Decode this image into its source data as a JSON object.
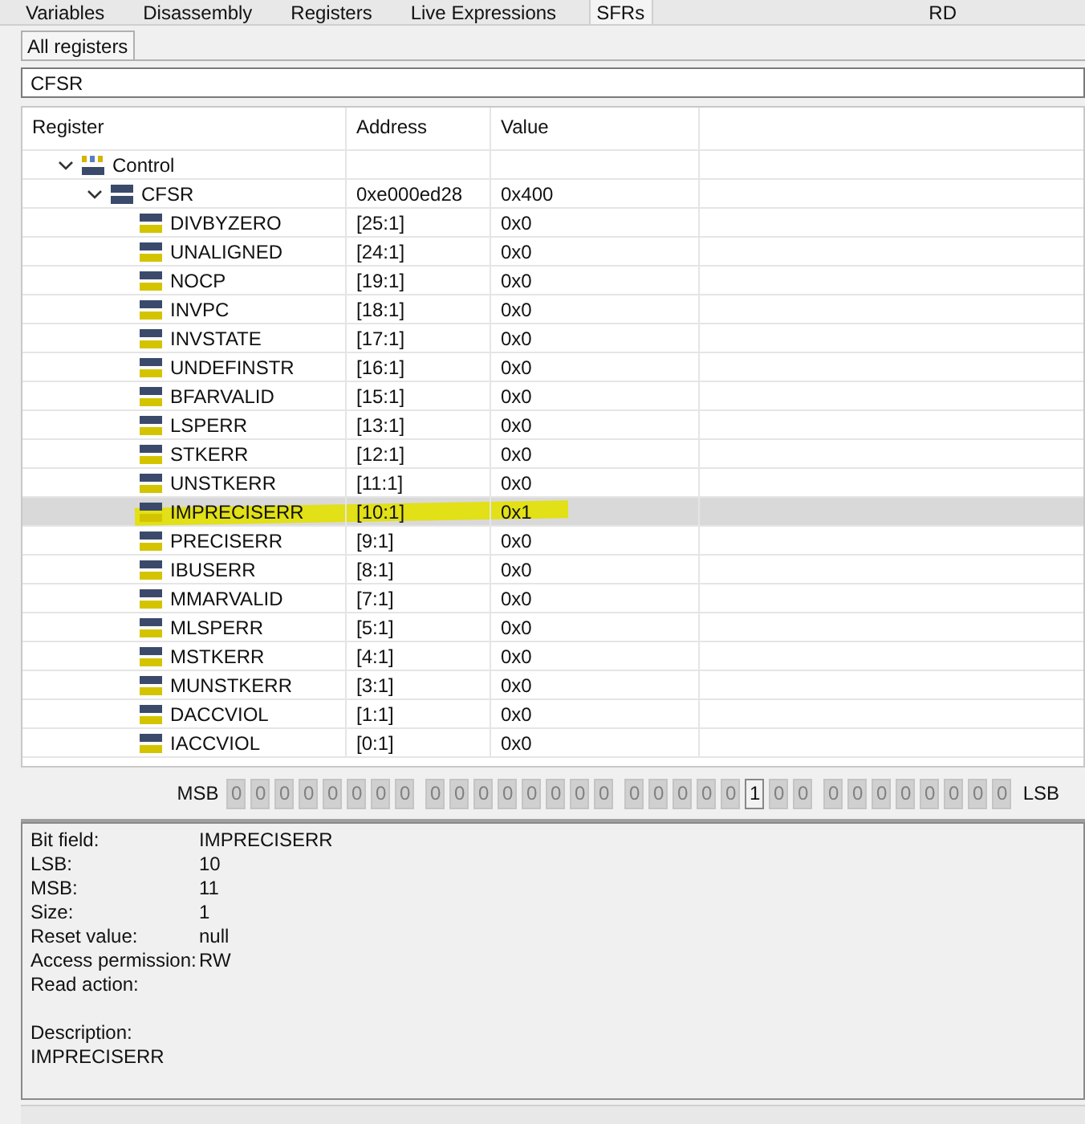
{
  "view_tabs": [
    {
      "label": "Variables",
      "selected": false
    },
    {
      "label": "Disassembly",
      "selected": false
    },
    {
      "label": "Registers",
      "selected": false
    },
    {
      "label": "Live Expressions",
      "selected": false
    },
    {
      "label": "SFRs",
      "selected": true
    }
  ],
  "toolbar": {
    "format_label": "RD"
  },
  "sub_tabs": [
    {
      "label": "All registers",
      "selected": true
    }
  ],
  "filter": {
    "value": "CFSR"
  },
  "table": {
    "columns": [
      "Register",
      "Address",
      "Value"
    ],
    "rows": [
      {
        "name": "Control",
        "kind": "group",
        "expanded": true,
        "selected": false,
        "marked": false,
        "children": [
          {
            "name": "CFSR",
            "kind": "register",
            "expanded": true,
            "address": "0xe000ed28",
            "value": "0x400",
            "selected": false,
            "marked": false,
            "children": [
              {
                "name": "DIVBYZERO",
                "kind": "field",
                "address": "[25:1]",
                "value": "0x0",
                "selected": false,
                "marked": false
              },
              {
                "name": "UNALIGNED",
                "kind": "field",
                "address": "[24:1]",
                "value": "0x0",
                "selected": false,
                "marked": false
              },
              {
                "name": "NOCP",
                "kind": "field",
                "address": "[19:1]",
                "value": "0x0",
                "selected": false,
                "marked": false
              },
              {
                "name": "INVPC",
                "kind": "field",
                "address": "[18:1]",
                "value": "0x0",
                "selected": false,
                "marked": false
              },
              {
                "name": "INVSTATE",
                "kind": "field",
                "address": "[17:1]",
                "value": "0x0",
                "selected": false,
                "marked": false
              },
              {
                "name": "UNDEFINSTR",
                "kind": "field",
                "address": "[16:1]",
                "value": "0x0",
                "selected": false,
                "marked": false
              },
              {
                "name": "BFARVALID",
                "kind": "field",
                "address": "[15:1]",
                "value": "0x0",
                "selected": false,
                "marked": false
              },
              {
                "name": "LSPERR",
                "kind": "field",
                "address": "[13:1]",
                "value": "0x0",
                "selected": false,
                "marked": false
              },
              {
                "name": "STKERR",
                "kind": "field",
                "address": "[12:1]",
                "value": "0x0",
                "selected": false,
                "marked": false
              },
              {
                "name": "UNSTKERR",
                "kind": "field",
                "address": "[11:1]",
                "value": "0x0",
                "selected": false,
                "marked": false
              },
              {
                "name": "IMPRECISERR",
                "kind": "field",
                "address": "[10:1]",
                "value": "0x1",
                "selected": true,
                "marked": true
              },
              {
                "name": "PRECISERR",
                "kind": "field",
                "address": "[9:1]",
                "value": "0x0",
                "selected": false,
                "marked": false
              },
              {
                "name": "IBUSERR",
                "kind": "field",
                "address": "[8:1]",
                "value": "0x0",
                "selected": false,
                "marked": false
              },
              {
                "name": "MMARVALID",
                "kind": "field",
                "address": "[7:1]",
                "value": "0x0",
                "selected": false,
                "marked": false
              },
              {
                "name": "MLSPERR",
                "kind": "field",
                "address": "[5:1]",
                "value": "0x0",
                "selected": false,
                "marked": false
              },
              {
                "name": "MSTKERR",
                "kind": "field",
                "address": "[4:1]",
                "value": "0x0",
                "selected": false,
                "marked": false
              },
              {
                "name": "MUNSTKERR",
                "kind": "field",
                "address": "[3:1]",
                "value": "0x0",
                "selected": false,
                "marked": false
              },
              {
                "name": "DACCVIOL",
                "kind": "field",
                "address": "[1:1]",
                "value": "0x0",
                "selected": false,
                "marked": false
              },
              {
                "name": "IACCVIOL",
                "kind": "field",
                "address": "[0:1]",
                "value": "0x0",
                "selected": false,
                "marked": false
              }
            ]
          }
        ]
      }
    ]
  },
  "bits": {
    "msb_label": "MSB",
    "lsb_label": "LSB",
    "groups": [
      [
        {
          "value": "0",
          "selected": false
        },
        {
          "value": "0",
          "selected": false
        },
        {
          "value": "0",
          "selected": false
        },
        {
          "value": "0",
          "selected": false
        },
        {
          "value": "0",
          "selected": false
        },
        {
          "value": "0",
          "selected": false
        },
        {
          "value": "0",
          "selected": false
        },
        {
          "value": "0",
          "selected": false
        }
      ],
      [
        {
          "value": "0",
          "selected": false
        },
        {
          "value": "0",
          "selected": false
        },
        {
          "value": "0",
          "selected": false
        },
        {
          "value": "0",
          "selected": false
        },
        {
          "value": "0",
          "selected": false
        },
        {
          "value": "0",
          "selected": false
        },
        {
          "value": "0",
          "selected": false
        },
        {
          "value": "0",
          "selected": false
        }
      ],
      [
        {
          "value": "0",
          "selected": false
        },
        {
          "value": "0",
          "selected": false
        },
        {
          "value": "0",
          "selected": false
        },
        {
          "value": "0",
          "selected": false
        },
        {
          "value": "0",
          "selected": false
        },
        {
          "value": "1",
          "selected": true
        },
        {
          "value": "0",
          "selected": false
        },
        {
          "value": "0",
          "selected": false
        }
      ],
      [
        {
          "value": "0",
          "selected": false
        },
        {
          "value": "0",
          "selected": false
        },
        {
          "value": "0",
          "selected": false
        },
        {
          "value": "0",
          "selected": false
        },
        {
          "value": "0",
          "selected": false
        },
        {
          "value": "0",
          "selected": false
        },
        {
          "value": "0",
          "selected": false
        },
        {
          "value": "0",
          "selected": false
        }
      ]
    ]
  },
  "details": [
    {
      "label": "Bit field:",
      "value": "IMPRECISERR"
    },
    {
      "label": "LSB:",
      "value": "10"
    },
    {
      "label": "MSB:",
      "value": "11"
    },
    {
      "label": "Size:",
      "value": "1"
    },
    {
      "label": "Reset value:",
      "value": "null"
    },
    {
      "label": "Access permission:",
      "value": "RW"
    },
    {
      "label": "Read action:"
    }
  ],
  "description": {
    "label": "Description:",
    "text": "IMPRECISERR"
  }
}
